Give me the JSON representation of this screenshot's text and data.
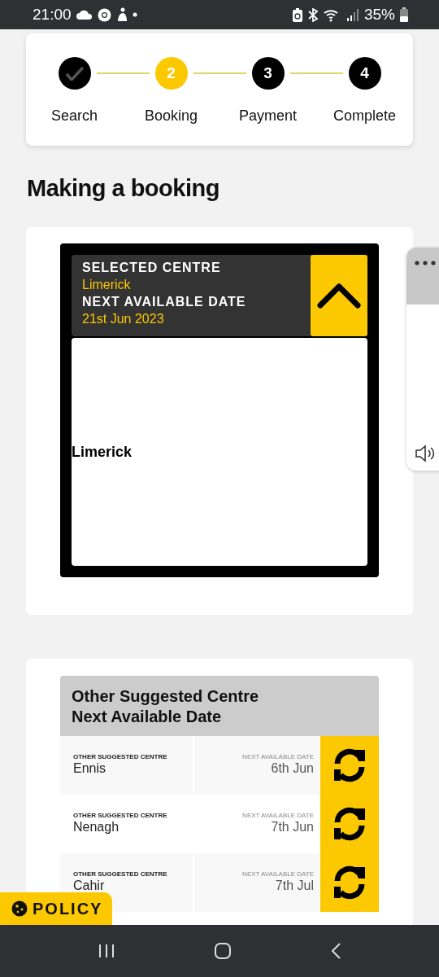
{
  "status_bar": {
    "time": "21:00",
    "battery": "35%"
  },
  "steps": [
    {
      "label": "Search",
      "kind": "done"
    },
    {
      "label": "Booking",
      "number": "2",
      "kind": "current"
    },
    {
      "label": "Payment",
      "number": "3",
      "kind": "todo"
    },
    {
      "label": "Complete",
      "number": "4",
      "kind": "todo"
    }
  ],
  "heading": "Making a booking",
  "selected_centre": {
    "centre_label": "SELECTED CENTRE",
    "centre": "Limerick",
    "date_label": "NEXT AVAILABLE DATE",
    "date": "21st Jun 2023",
    "expanded": true,
    "map_label": "Limerick"
  },
  "suggestions": {
    "title_lines": [
      "Other Suggested Centre",
      "Next Available Date"
    ],
    "rows": [
      {
        "centre_label": "OTHER SUGGESTED CENTRE",
        "centre": "Ennis",
        "date_label": "NEXT AVAILABLE DATE",
        "date": "6th Jun"
      },
      {
        "centre_label": "OTHER SUGGESTED CENTRE",
        "centre": "Nenagh",
        "date_label": "NEXT AVAILABLE DATE",
        "date": "7th Jun"
      },
      {
        "centre_label": "OTHER SUGGESTED CENTRE",
        "centre": "Cahir",
        "date_label": "NEXT AVAILABLE DATE",
        "date": "7th Jul"
      }
    ]
  },
  "policy_button": "POLICY"
}
